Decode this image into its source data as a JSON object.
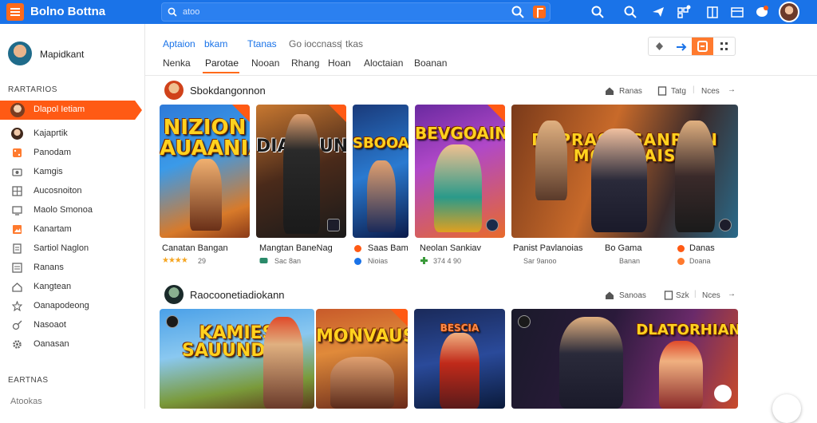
{
  "app": {
    "title": "Bolno Bottna"
  },
  "search": {
    "placeholder": "atoo"
  },
  "user": {
    "name": "Mapidkant"
  },
  "sidebar": {
    "section1": "RARTARIOS",
    "items": [
      {
        "label": "Dlapol Ietiam",
        "icon": "user-avatar-icon"
      },
      {
        "label": "Kajaprtik",
        "icon": "user-avatar-icon"
      },
      {
        "label": "Panodam",
        "icon": "dice-icon"
      },
      {
        "label": "Kamgis",
        "icon": "camera-icon"
      },
      {
        "label": "Aucosnoiton",
        "icon": "grid-icon"
      },
      {
        "label": "Maolo Smonoa",
        "icon": "monitor-icon"
      },
      {
        "label": "Kanartam",
        "icon": "image-icon"
      },
      {
        "label": "Sartiol Naglon",
        "icon": "doc-icon"
      },
      {
        "label": "Ranans",
        "icon": "list-icon"
      },
      {
        "label": "Kangtean",
        "icon": "home-icon"
      },
      {
        "label": "Oanapodeong",
        "icon": "star-icon"
      },
      {
        "label": "Nasoaot",
        "icon": "pen-icon"
      },
      {
        "label": "Oanasan",
        "icon": "gear-icon"
      }
    ],
    "section2": "EARTNAS",
    "footer_item": "Atookas"
  },
  "breadcrumbs": [
    "Aptaion",
    "bkam",
    "Ttanas",
    "Go ioccnass",
    "tkas"
  ],
  "tabs": [
    "Nenka",
    "Parotae",
    "Nooan",
    "Rhang",
    "Hoan",
    "Aloctaian",
    "Boanan"
  ],
  "active_tab": 1,
  "sections": [
    {
      "title": "Sbokdangonnon",
      "actions": [
        "Ranas",
        "Tatg",
        "Nces"
      ],
      "cards": [
        {
          "art": "NIZION\nAUAANIAN",
          "title": "Canatan Bangan",
          "sub": "29",
          "rating": "★★★★"
        },
        {
          "art": "DIABOUN",
          "title": "Mangtan BaneNag",
          "sub": "Sac 8an"
        },
        {
          "art": "SBOOAOD",
          "title": "Saas Bam",
          "sub": "Nioias"
        },
        {
          "art": "BEVGOAIN",
          "title": "Neolan Sankiav",
          "sub": "374 4 90"
        },
        {
          "art": "DAPRAOK  SANRAIN\nMONOLAIS",
          "title": "Panist Pavlanoias",
          "sub": "Sar 9anoo"
        },
        {
          "art": "",
          "title": "Bo Gama",
          "sub": "Banan"
        },
        {
          "art": "",
          "title": "Danas",
          "sub": "Doana"
        }
      ]
    },
    {
      "title": "Raocoonetiadiokann",
      "actions": [
        "Sanoas",
        "Szk",
        "Nces"
      ],
      "cards": [
        {
          "art": "KAMIES\nSAUUNDEN"
        },
        {
          "art": "MONVAUS"
        },
        {
          "art": "BESCIA"
        },
        {
          "art": "DLATORHIAN"
        }
      ]
    }
  ],
  "colors": {
    "topbar": "#1a73e8",
    "accent": "#ff5a14"
  }
}
